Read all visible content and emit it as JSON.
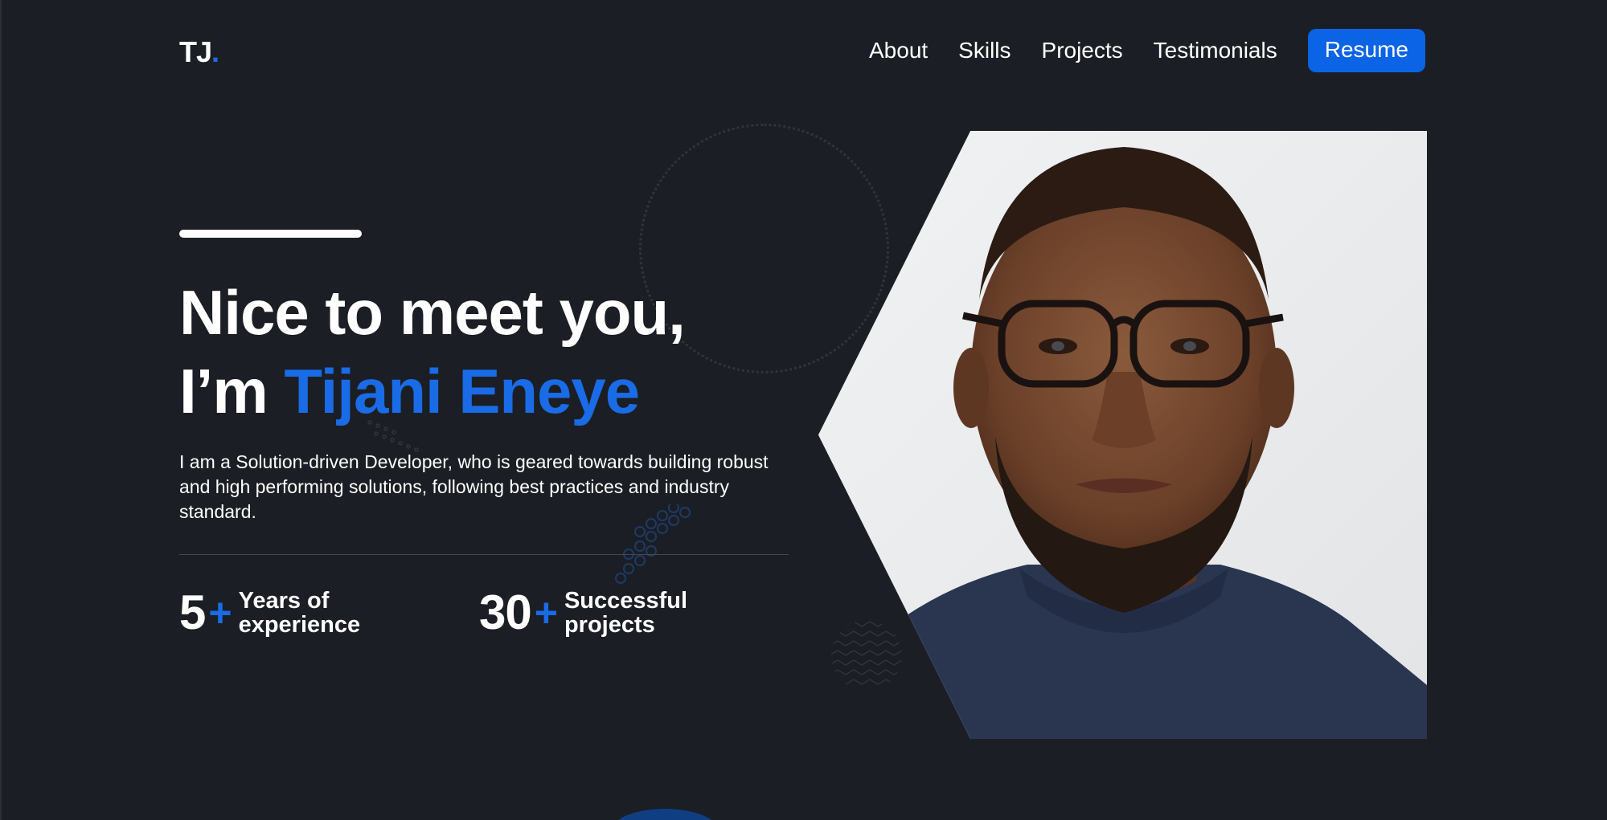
{
  "logo": {
    "text": "TJ",
    "dot": "."
  },
  "nav": {
    "items": [
      "About",
      "Skills",
      "Projects",
      "Testimonials"
    ],
    "resume_label": "Resume"
  },
  "hero": {
    "line1": "Nice to meet you,",
    "line2_prefix": "I’m ",
    "name": "Tijani Eneye",
    "description": "I am a Solution-driven Developer, who is geared towards building robust and high performing solutions, following best practices and industry standard."
  },
  "stats": [
    {
      "number": "5",
      "plus": "+",
      "label_line1": "Years of",
      "label_line2": "experience"
    },
    {
      "number": "30",
      "plus": "+",
      "label_line1": "Successful",
      "label_line2": "projects"
    }
  ],
  "colors": {
    "background": "#1b1e24",
    "accent": "#1a6be6",
    "button": "#0b63e5"
  }
}
